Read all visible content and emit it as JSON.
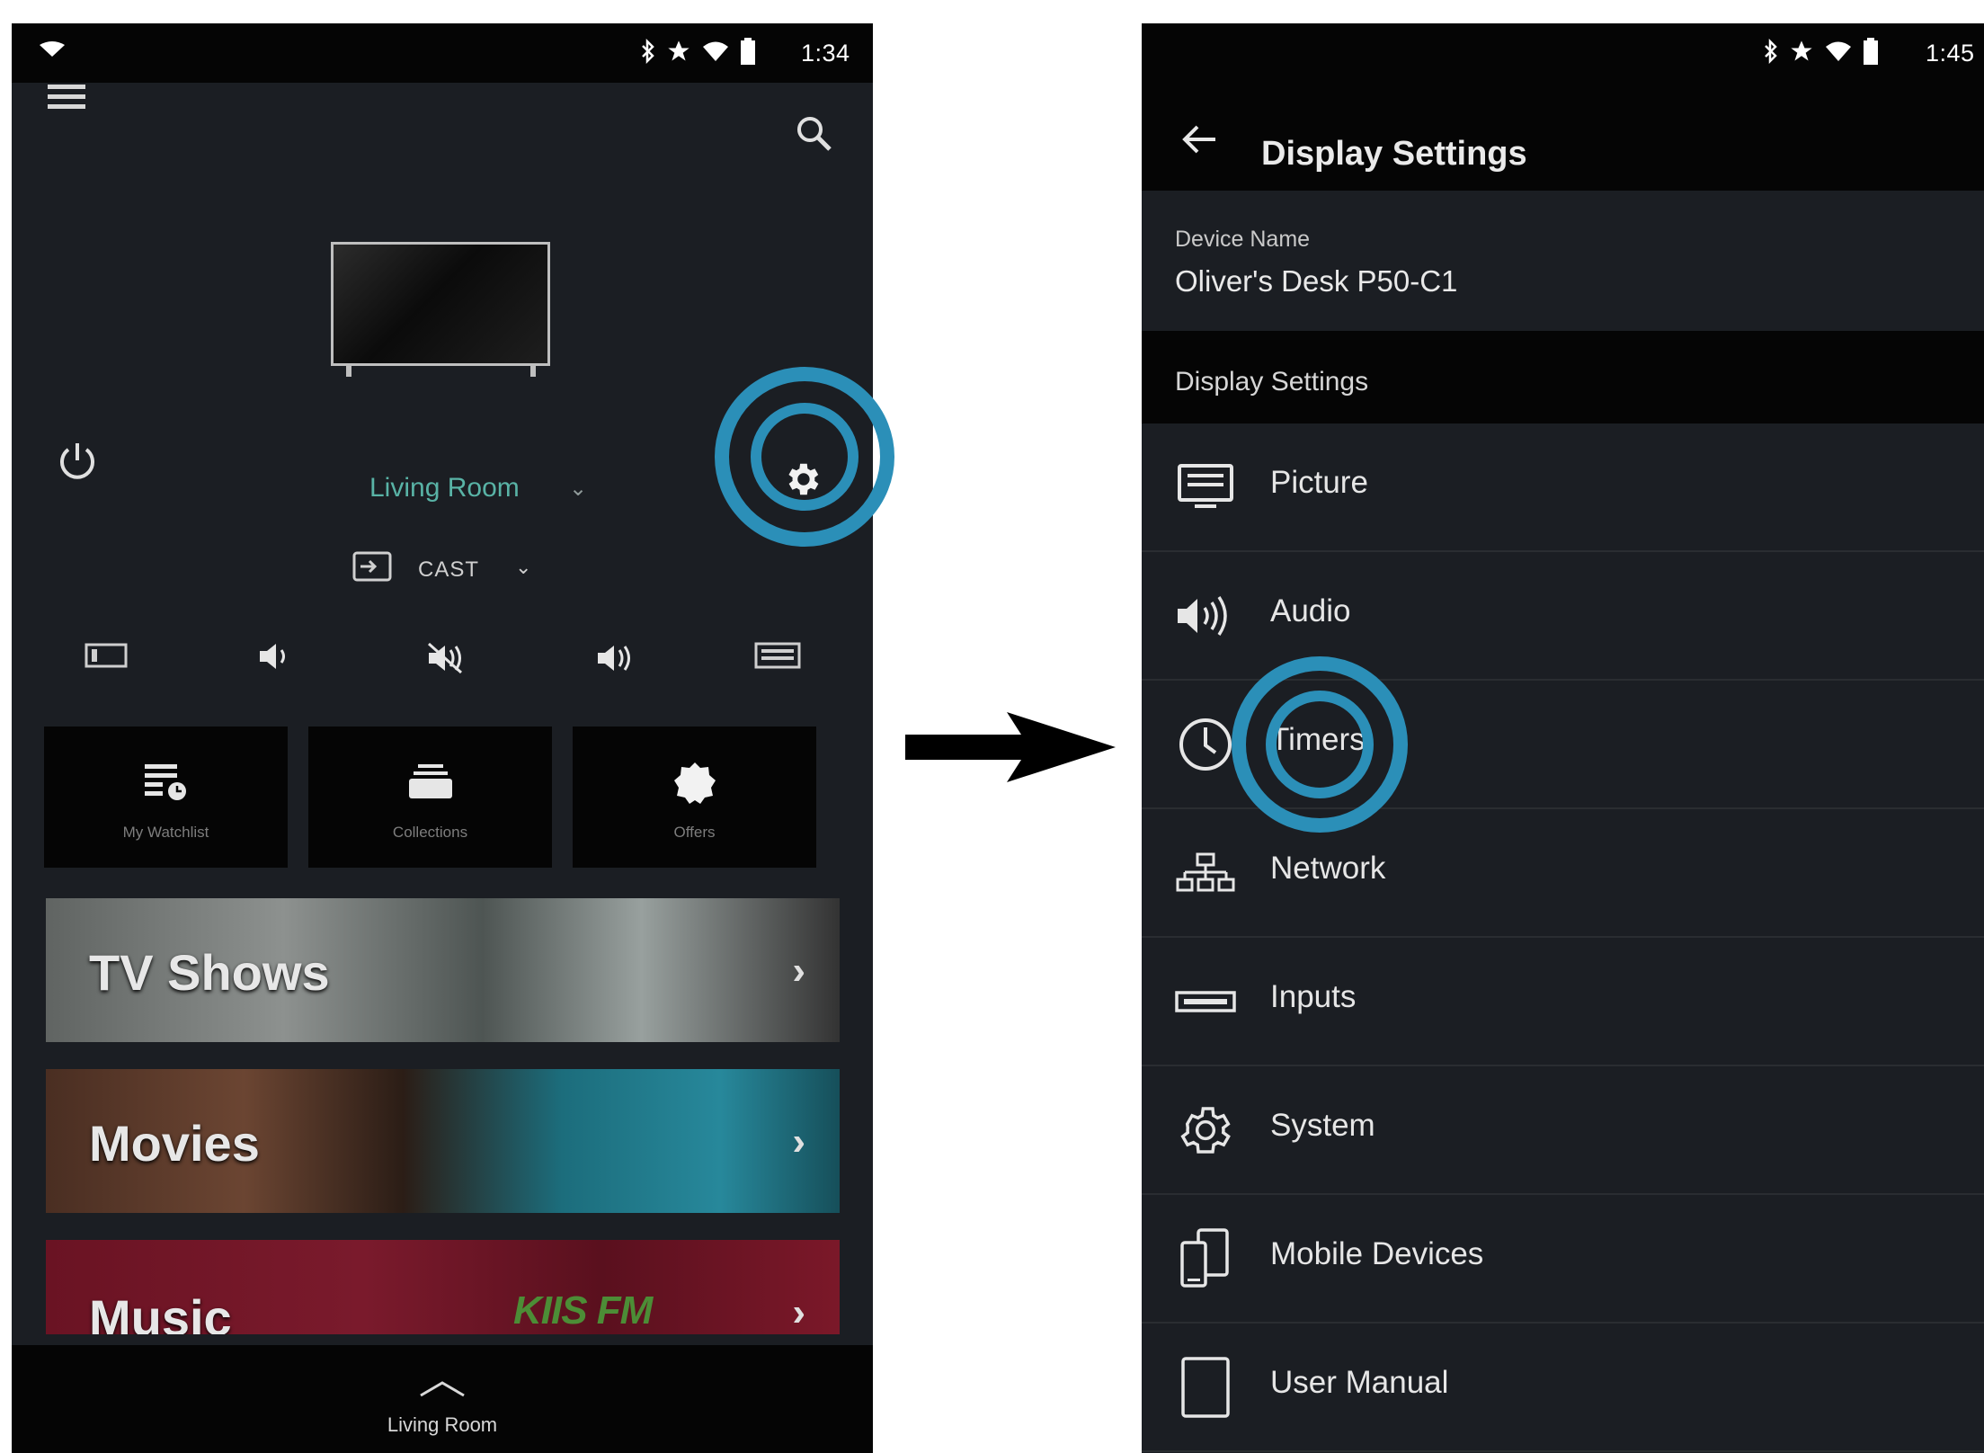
{
  "left_screen": {
    "status_bar": {
      "time": "1:34"
    },
    "tv_selector": {
      "room": "Living Room"
    },
    "input": {
      "label": "CAST"
    },
    "tiles": [
      {
        "label": "My Watchlist"
      },
      {
        "label": "Collections"
      },
      {
        "label": "Offers"
      }
    ],
    "banners": [
      {
        "title": "TV Shows"
      },
      {
        "title": "Movies"
      },
      {
        "title": "Music",
        "badge": "KIIS FM"
      }
    ],
    "bottom_bar": {
      "label": "Living Room"
    }
  },
  "right_screen": {
    "status_bar": {
      "time": "1:45"
    },
    "title": "Display Settings",
    "device": {
      "key": "Device Name",
      "value": "Oliver's Desk P50-C1"
    },
    "section_header": "Display Settings",
    "menu": [
      {
        "label": "Picture",
        "icon": "picture-icon"
      },
      {
        "label": "Audio",
        "icon": "audio-icon"
      },
      {
        "label": "Timers",
        "icon": "clock-icon"
      },
      {
        "label": "Network",
        "icon": "network-icon"
      },
      {
        "label": "Inputs",
        "icon": "inputs-icon"
      },
      {
        "label": "System",
        "icon": "gear-icon"
      },
      {
        "label": "Mobile Devices",
        "icon": "mobile-devices-icon"
      },
      {
        "label": "User Manual",
        "icon": "manual-icon"
      }
    ]
  },
  "colors": {
    "highlight_ring": "#2b8fb8",
    "accent_room": "#59b3a6",
    "background": "#1b1e23"
  }
}
